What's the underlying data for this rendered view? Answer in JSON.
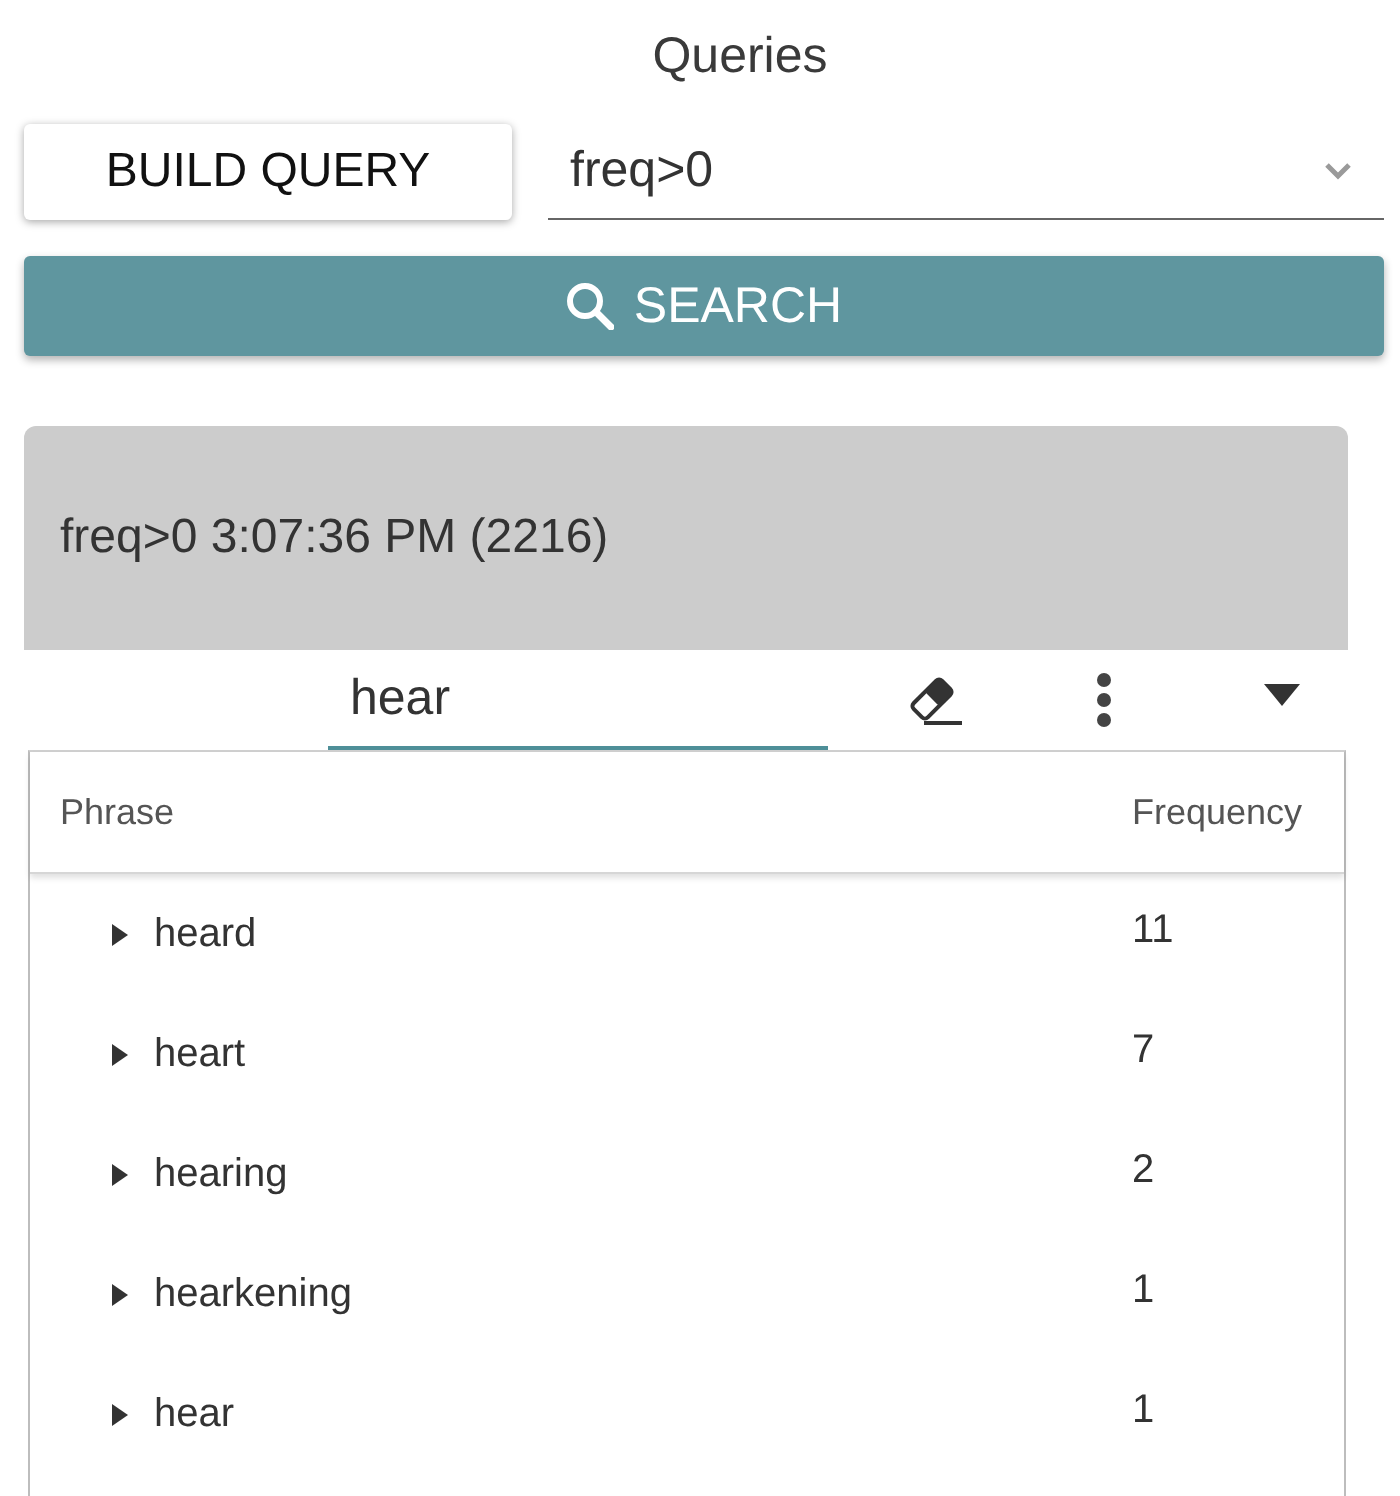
{
  "title": "Queries",
  "query_controls": {
    "build_button": "BUILD QUERY",
    "query_select": {
      "value": "freq>0"
    },
    "search_button": "SEARCH"
  },
  "result_panel": {
    "header": "freq>0 3:07:36 PM (2216)",
    "filter_field": {
      "value": "hear"
    },
    "table": {
      "columns": [
        "Phrase",
        "Frequency"
      ],
      "rows": [
        {
          "phrase": "heard",
          "frequency": "11",
          "expanded": false
        },
        {
          "phrase": "heart",
          "frequency": "7",
          "expanded": false
        },
        {
          "phrase": "hearing",
          "frequency": "2",
          "expanded": false
        },
        {
          "phrase": "hearkening",
          "frequency": "1",
          "expanded": false
        },
        {
          "phrase": "hear",
          "frequency": "1",
          "expanded": false
        }
      ]
    }
  }
}
